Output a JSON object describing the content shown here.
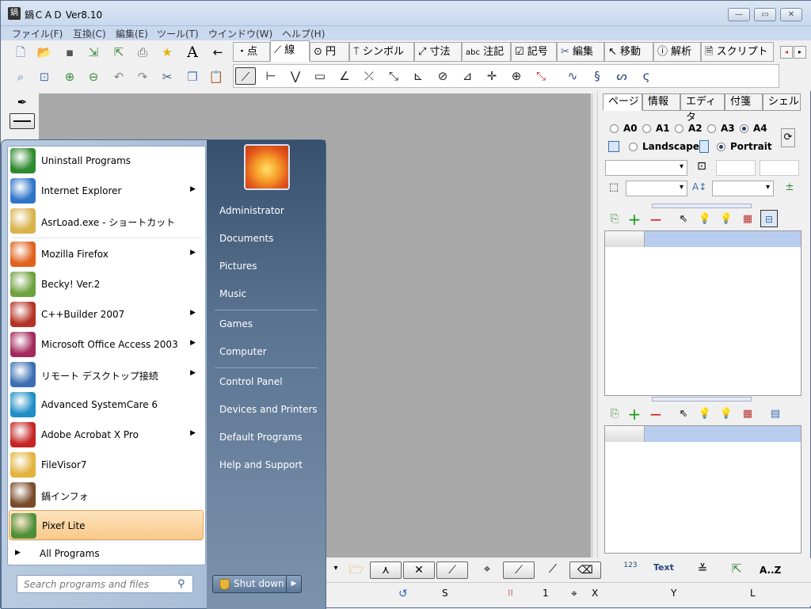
{
  "window": {
    "title": "鍋ＣＡＤ Ver8.10",
    "controls": {
      "minimize": "—",
      "maximize": "▭",
      "close": "✕"
    }
  },
  "menubar": [
    "ファイル(F)",
    "互換(C)",
    "編集(E)",
    "ツール(T)",
    "ウインドウ(W)",
    "ヘルプ(H)"
  ],
  "tool_tabs": [
    {
      "label": "・点"
    },
    {
      "label": "線"
    },
    {
      "label": "円"
    },
    {
      "label": "シンボル"
    },
    {
      "label": "寸法"
    },
    {
      "label": "注記",
      "prefix": "abc"
    },
    {
      "label": "記号"
    },
    {
      "label": "編集"
    },
    {
      "label": "移動"
    },
    {
      "label": "解析"
    },
    {
      "label": "スクリプト"
    }
  ],
  "selected_tool_tab": "線",
  "right_panel": {
    "tabs": [
      "ページ",
      "情報",
      "エディタ",
      "付箋",
      "シェル"
    ],
    "paper_sizes": [
      "A0",
      "A1",
      "A2",
      "A3",
      "A4"
    ],
    "selected_paper": "A4",
    "orientations": [
      "Landscape",
      "Portrait"
    ],
    "selected_orientation": "Portrait"
  },
  "status": {
    "s_label": "S",
    "value": "1",
    "x_label": "X",
    "y_label": "Y",
    "l_label": "L"
  },
  "bottom_toolbar": {
    "text_label": "Text",
    "az_label": "A..Z",
    "num_label": "123"
  },
  "start_menu": {
    "programs": [
      {
        "label": "Uninstall Programs",
        "arrow": false,
        "icon": "uninstall-icon",
        "color": "#2e8a2e"
      },
      {
        "label": "Internet Explorer",
        "arrow": true,
        "icon": "ie-icon",
        "color": "#2f74c9"
      },
      {
        "label": "AsrLoad.exe - ショートカット",
        "arrow": false,
        "icon": "folder-icon",
        "color": "#d9b24a"
      },
      {
        "label": "Mozilla Firefox",
        "arrow": true,
        "icon": "firefox-icon",
        "color": "#e0621c"
      },
      {
        "label": "Becky! Ver.2",
        "arrow": false,
        "icon": "becky-icon",
        "color": "#6fa23f"
      },
      {
        "label": "C++Builder 2007",
        "arrow": true,
        "icon": "cbuilder-icon",
        "color": "#b53324"
      },
      {
        "label": "Microsoft Office Access 2003",
        "arrow": true,
        "icon": "access-icon",
        "color": "#a3295c"
      },
      {
        "label": "リモート デスクトップ接続",
        "arrow": true,
        "icon": "remote-desktop-icon",
        "color": "#3b6fb3"
      },
      {
        "label": "Advanced SystemCare 6",
        "arrow": false,
        "icon": "systemcare-icon",
        "color": "#1f8fc6"
      },
      {
        "label": "Adobe Acrobat X Pro",
        "arrow": true,
        "icon": "acrobat-icon",
        "color": "#c62525"
      },
      {
        "label": "FileVisor7",
        "arrow": false,
        "icon": "filevisor-icon",
        "color": "#e3b33d"
      },
      {
        "label": "鍋インフォ",
        "arrow": false,
        "icon": "nabe-info-icon",
        "color": "#7a4a2b"
      },
      {
        "label": "Pixef Lite",
        "arrow": false,
        "icon": "pixef-icon",
        "color": "#4f8f3a",
        "selected": true
      }
    ],
    "all_programs": "All Programs",
    "search_placeholder": "Search programs and files",
    "right_links_1": [
      "Administrator",
      "Documents",
      "Pictures",
      "Music"
    ],
    "right_links_2": [
      "Games",
      "Computer"
    ],
    "right_links_3": [
      "Control Panel",
      "Devices and Printers",
      "Default Programs",
      "Help and Support"
    ],
    "shutdown": "Shut down"
  }
}
